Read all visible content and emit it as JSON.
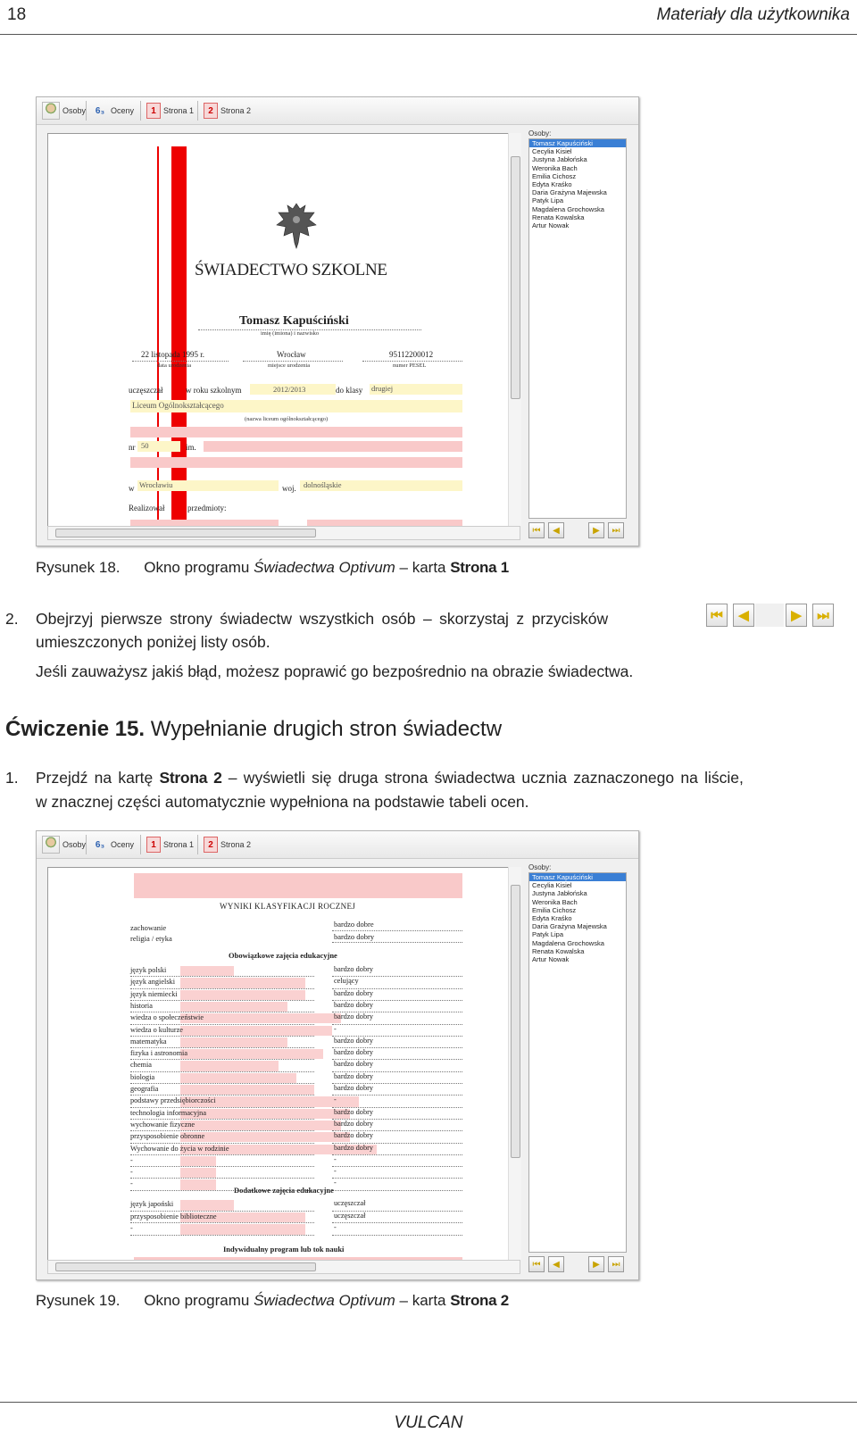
{
  "page": {
    "number": "18",
    "running_title": "Materiały dla użytkownika",
    "footer": "VULCAN"
  },
  "window_common": {
    "tabs": [
      {
        "label": "Osoby"
      },
      {
        "label": "Oceny"
      },
      {
        "label": "Strona 1",
        "num": "1"
      },
      {
        "label": "Strona 2",
        "num": "2"
      }
    ],
    "persons_label": "Osoby:",
    "persons": [
      "Tomasz Kapuściński",
      "Cecylia Kisiel",
      "Justyna Jabłońska",
      "Weronika Bach",
      "Emilia Cichosz",
      "Edyta Kraśko",
      "Daria Grażyna Majewska",
      "Patyk Lipa",
      "Magdalena Grochowska",
      "Renata Kowalska",
      "Artur Nowak"
    ],
    "selected_person": "Tomasz Kapuściński"
  },
  "figure18": {
    "cert_title": "ŚWIADECTWO SZKOLNE",
    "student_name": "Tomasz Kapuściński",
    "name_caption": "imię (imiona) i nazwisko",
    "birth_date": "22 listopada 1995 r.",
    "birth_date_caption": "data urodzenia",
    "birth_place": "Wrocław",
    "birth_place_caption": "miejsce urodzenia",
    "pesel": "95112200012",
    "pesel_caption": "numer PESEL",
    "row1_prefix": "uczęszczał",
    "row1_mid": "w roku szkolnym",
    "school_year": "2012/2013",
    "class_label": "do klasy",
    "class_value": "drugiej",
    "school_name": "Liceum Ogólnokształcącego",
    "school_caption": "(nazwa liceum ogólnokształcącego)",
    "nr_label": "nr",
    "nr_value": "50",
    "im_label": "im.",
    "w_label": "w",
    "city": "Wrocławiu",
    "woj_label": "woj.",
    "woj_value": "dolnośląskie",
    "realizowal": "Realizował",
    "przedmioty": "przedmioty:"
  },
  "caption18": {
    "label": "Rysunek 18.",
    "pre": "Okno programu ",
    "app": "Świadectwa Optivum",
    "mid": " – karta ",
    "tab": "Strona 1"
  },
  "step2": {
    "num": "2.",
    "line1": "Obejrzyj pierwsze strony świadectw wszystkich osób – skorzystaj z przycisków",
    "line2": "umieszczonych poniżej listy osób.",
    "line3": "Jeśli zauważysz jakiś błąd, możesz poprawić go bezpośrednio na obrazie świadectwa."
  },
  "exercise": {
    "label": "Ćwiczenie 15.",
    "title": "Wypełnianie drugich stron świadectw"
  },
  "step1": {
    "num": "1.",
    "pre": "Przejdź na kartę ",
    "tab": "Strona 2",
    "post": " – wyświetli się druga strona świadectwa ucznia zaznaczonego na liście,",
    "line2": "w znacznej części automatycznie wypełniona na podstawie tabeli ocen."
  },
  "figure19": {
    "header": "WYNIKI KLASYFIKACJI ROCZNEJ",
    "behavior_rows": [
      {
        "subject": "zachowanie",
        "grade": "bardzo dobre"
      },
      {
        "subject": "religia / etyka",
        "grade": "bardzo dobry"
      }
    ],
    "mandatory_header": "Obowiązkowe zajęcia edukacyjne",
    "subjects": [
      {
        "subject": "język polski",
        "grade": "bardzo dobry"
      },
      {
        "subject": "język  angielski",
        "grade": "celujący"
      },
      {
        "subject": "język  niemiecki",
        "grade": "bardzo dobry"
      },
      {
        "subject": "historia",
        "grade": "bardzo dobry"
      },
      {
        "subject": "wiedza o społeczeństwie",
        "grade": "bardzo dobry"
      },
      {
        "subject": "wiedza o kulturze",
        "grade": "-"
      },
      {
        "subject": "matematyka",
        "grade": "bardzo dobry"
      },
      {
        "subject": "fizyka i astronomia",
        "grade": "bardzo dobry"
      },
      {
        "subject": "chemia",
        "grade": "bardzo dobry"
      },
      {
        "subject": "biologia",
        "grade": "bardzo dobry"
      },
      {
        "subject": "geografia",
        "grade": "bardzo dobry"
      },
      {
        "subject": "podstawy przedsiębiorczości",
        "grade": "-"
      },
      {
        "subject": "technologia informacyjna",
        "grade": "bardzo dobry"
      },
      {
        "subject": "wychowanie fizyczne",
        "grade": "bardzo dobry"
      },
      {
        "subject": "przysposobienie obronne",
        "grade": "bardzo dobry"
      },
      {
        "subject": "Wychowanie do życia w rodzinie",
        "grade": "bardzo dobry"
      },
      {
        "subject": "-",
        "grade": "-"
      },
      {
        "subject": "-",
        "grade": "-"
      },
      {
        "subject": "-",
        "grade": "-"
      }
    ],
    "additional_header": "Dodatkowe zajęcia edukacyjne",
    "additional": [
      {
        "subject": "język japoński",
        "grade": "uczęszczał"
      },
      {
        "subject": "przysposobienie biblioteczne",
        "grade": "uczęszczał"
      },
      {
        "subject": "-",
        "grade": "-"
      }
    ],
    "individual": "Indywidualny program lub tok nauki"
  },
  "caption19": {
    "label": "Rysunek 19.",
    "pre": "Okno programu ",
    "app": "Świadectwa Optivum",
    "mid": " – karta ",
    "tab": "Strona 2"
  }
}
